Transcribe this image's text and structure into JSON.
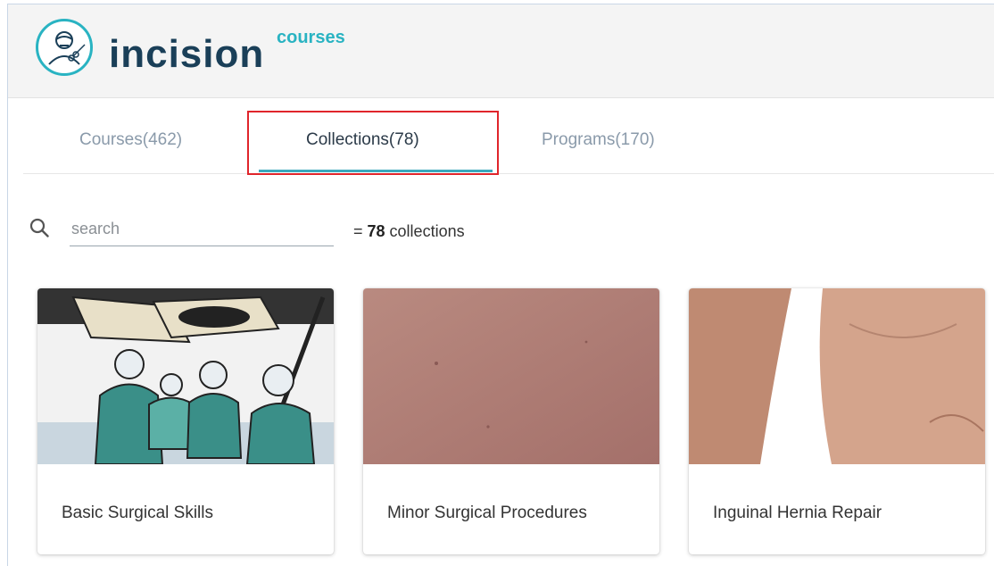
{
  "brand": {
    "name": "incision",
    "sub": "courses"
  },
  "tabs": [
    {
      "label": "Courses(462)"
    },
    {
      "label": "Collections(78)"
    },
    {
      "label": "Programs(170)"
    }
  ],
  "search": {
    "placeholder": "search"
  },
  "count": {
    "prefix": "= ",
    "number": "78",
    "suffix": " collections"
  },
  "cards": [
    {
      "title": "Basic Surgical Skills"
    },
    {
      "title": "Minor Surgical Procedures"
    },
    {
      "title": "Inguinal Hernia Repair"
    }
  ],
  "colors": {
    "accent": "#29b3c2",
    "tab_underline": "#3aa9bd",
    "highlight": "#e0252b",
    "brand_text": "#1a3f58"
  }
}
